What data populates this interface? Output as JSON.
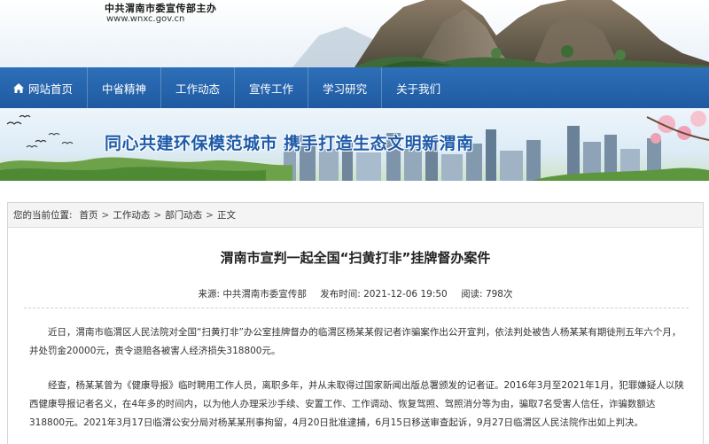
{
  "header": {
    "title": "中共渭南市委宣传部主办",
    "url": "www.wnxc.gov.cn"
  },
  "nav": {
    "items": [
      {
        "label": "网站首页",
        "icon": "home-icon"
      },
      {
        "label": "中省精神"
      },
      {
        "label": "工作动态"
      },
      {
        "label": "宣传工作"
      },
      {
        "label": "学习研究"
      },
      {
        "label": "关于我们"
      }
    ]
  },
  "banner": {
    "slogan": "同心共建环保模范城市  携手打造生态文明新渭南"
  },
  "breadcrumb": {
    "prefix": "您的当前位置:",
    "items": [
      "首页",
      "工作动态",
      "部门动态",
      "正文"
    ]
  },
  "article": {
    "title": "渭南市宣判一起全国“扫黄打非”挂牌督办案件",
    "source": "来源:  中共渭南市委宣传部",
    "time": "发布时间:  2021-12-06 19:50",
    "views": "阅读:  798次",
    "paragraphs": [
      "近日，渭南市临渭区人民法院对全国“扫黄打非”办公室挂牌督办的临渭区杨某某假记者诈骗案作出公开宣判，依法判处被告人杨某某有期徒刑五年六个月，并处罚金20000元，责令退赔各被害人经济损失318800元。",
      "经查，杨某某曾为《健康导报》临时聘用工作人员，离职多年，并从未取得过国家新闻出版总署颁发的记者证。2016年3月至2021年1月，犯罪嫌疑人以陕西健康导报记者名义，在4年多的时间内，以为他人办理采沙手续、安置工作、工作调动、恢复驾照、驾照消分等为由，骗取7名受害人信任，诈骗数额达318800元。2021年3月17日临渭公安分局对杨某某刑事拘留，4月20日批准逮捕，6月15日移送审查起诉，9月27日临渭区人民法院作出如上判决。"
    ]
  },
  "colors": {
    "nav_blue": "#2163ad",
    "slogan_blue": "#1d5aa8"
  }
}
